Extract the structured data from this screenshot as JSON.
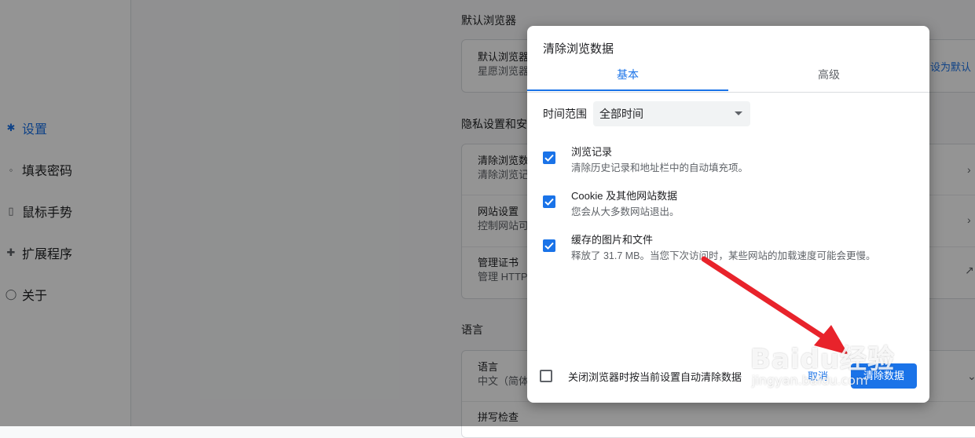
{
  "sidebar": {
    "items": [
      {
        "label": "设置",
        "icon": "gear-icon",
        "active": true
      },
      {
        "label": "填表密码",
        "icon": "key-icon",
        "active": false
      },
      {
        "label": "鼠标手势",
        "icon": "mouse-icon",
        "active": false
      },
      {
        "label": "扩展程序",
        "icon": "puzzle-icon",
        "active": false
      },
      {
        "label": "关于",
        "icon": "info-icon",
        "active": false
      }
    ]
  },
  "settings": {
    "default_browser_title": "默认浏览器",
    "default_browser_row_title": "默认浏览器",
    "default_browser_row_sub": "星愿浏览器",
    "set_default_label": "设为默认",
    "privacy_title": "隐私设置和安",
    "clear_row_title": "清除浏览数",
    "clear_row_sub": "清除浏览记",
    "site_row_title": "网站设置",
    "site_row_sub": "控制网站可",
    "cert_row_title": "管理证书",
    "cert_row_sub": "管理 HTTPS",
    "language_title": "语言",
    "lang_row_title": "语言",
    "lang_row_sub": "中文（简体",
    "spell_row_title": "拼写检查"
  },
  "dialog": {
    "title": "清除浏览数据",
    "tabs": [
      "基本",
      "高级"
    ],
    "time_range_label": "时间范围",
    "time_range_value": "全部时间",
    "options": [
      {
        "title": "浏览记录",
        "sub": "清除历史记录和地址栏中的自动填充项。",
        "checked": true
      },
      {
        "title": "Cookie 及其他网站数据",
        "sub": "您会从大多数网站退出。",
        "checked": true
      },
      {
        "title": "缓存的图片和文件",
        "sub": "释放了 31.7 MB。当您下次访问时，某些网站的加载速度可能会更慢。",
        "checked": true
      }
    ],
    "auto_clear_label": "关闭浏览器时按当前设置自动清除数据",
    "auto_clear_checked": false,
    "cancel_label": "取消",
    "clear_label": "清除数据"
  },
  "watermark": {
    "top": "Baidu经验",
    "bottom": "jingyan.baidu.com"
  },
  "colors": {
    "accent": "#1a73e8",
    "arrow": "#e8232b"
  }
}
